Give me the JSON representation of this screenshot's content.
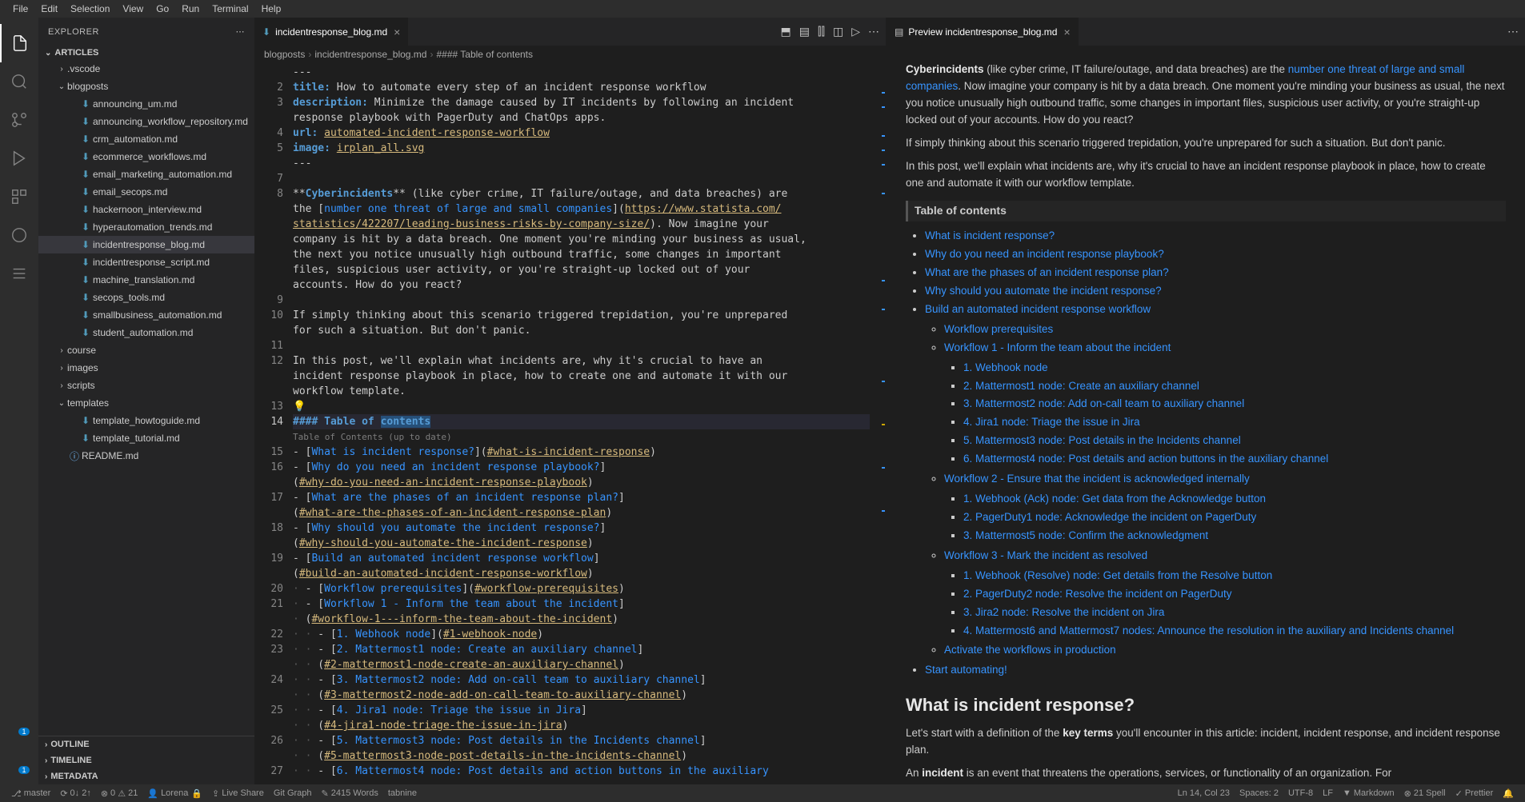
{
  "menubar": [
    "File",
    "Edit",
    "Selection",
    "View",
    "Go",
    "Run",
    "Terminal",
    "Help"
  ],
  "sidebar": {
    "title": "EXPLORER",
    "root": "ARTICLES",
    "tree": [
      {
        "type": "folder",
        "name": ".vscode",
        "depth": 1,
        "expanded": false
      },
      {
        "type": "folder",
        "name": "blogposts",
        "depth": 1,
        "expanded": true
      },
      {
        "type": "file",
        "name": "announcing_um.md",
        "depth": 2
      },
      {
        "type": "file",
        "name": "announcing_workflow_repository.md",
        "depth": 2
      },
      {
        "type": "file",
        "name": "crm_automation.md",
        "depth": 2
      },
      {
        "type": "file",
        "name": "ecommerce_workflows.md",
        "depth": 2
      },
      {
        "type": "file",
        "name": "email_marketing_automation.md",
        "depth": 2
      },
      {
        "type": "file",
        "name": "email_secops.md",
        "depth": 2
      },
      {
        "type": "file",
        "name": "hackernoon_interview.md",
        "depth": 2
      },
      {
        "type": "file",
        "name": "hyperautomation_trends.md",
        "depth": 2
      },
      {
        "type": "file",
        "name": "incidentresponse_blog.md",
        "depth": 2,
        "selected": true
      },
      {
        "type": "file",
        "name": "incidentresponse_script.md",
        "depth": 2
      },
      {
        "type": "file",
        "name": "machine_translation.md",
        "depth": 2
      },
      {
        "type": "file",
        "name": "secops_tools.md",
        "depth": 2
      },
      {
        "type": "file",
        "name": "smallbusiness_automation.md",
        "depth": 2
      },
      {
        "type": "file",
        "name": "student_automation.md",
        "depth": 2
      },
      {
        "type": "folder",
        "name": "course",
        "depth": 1,
        "expanded": false
      },
      {
        "type": "folder",
        "name": "images",
        "depth": 1,
        "expanded": false
      },
      {
        "type": "folder",
        "name": "scripts",
        "depth": 1,
        "expanded": false
      },
      {
        "type": "folder",
        "name": "templates",
        "depth": 1,
        "expanded": true
      },
      {
        "type": "file",
        "name": "template_howtoguide.md",
        "depth": 2
      },
      {
        "type": "file",
        "name": "template_tutorial.md",
        "depth": 2
      },
      {
        "type": "file",
        "name": "README.md",
        "depth": 1,
        "icon": "info"
      }
    ],
    "collapsed": [
      "OUTLINE",
      "TIMELINE",
      "METADATA"
    ]
  },
  "leftTab": {
    "name": "incidentresponse_blog.md"
  },
  "rightTab": {
    "name": "Preview incidentresponse_blog.md"
  },
  "breadcrumbs": [
    "blogposts",
    "incidentresponse_blog.md",
    "#### Table of contents"
  ],
  "editorLines": [
    {
      "n": "",
      "html": "---"
    },
    {
      "n": "2",
      "html": "<span class='mtk-key'>title:</span> How to automate every step of an incident response workflow"
    },
    {
      "n": "3",
      "html": "<span class='mtk-key'>description:</span> Minimize the damage caused by IT incidents by following an incident"
    },
    {
      "n": "",
      "html": "response playbook with PagerDuty and ChatOps apps."
    },
    {
      "n": "4",
      "html": "<span class='mtk-key'>url:</span> <span class='mtk-link'>automated-incident-response-workflow</span>"
    },
    {
      "n": "5",
      "html": "<span class='mtk-key'>image:</span> <span class='mtk-link'>irplan_all.svg</span>"
    },
    {
      "n": "",
      "html": "---"
    },
    {
      "n": "7",
      "html": ""
    },
    {
      "n": "8",
      "html": "**<span class='mtk-bold'>Cyberincidents</span>** (like cyber crime, IT failure/outage, and data breaches) are"
    },
    {
      "n": "",
      "html": "the [<span class='mtk-link2'>number one threat of large and small companies</span>](<span class='mtk-link'>https://www.statista.com/</span>"
    },
    {
      "n": "",
      "html": "<span class='mtk-link'>statistics/422207/leading-business-risks-by-company-size/</span>). Now imagine your"
    },
    {
      "n": "",
      "html": "company is hit by a data breach. One moment you're minding your business as usual,"
    },
    {
      "n": "",
      "html": "the next you notice unusually high outbound traffic, some changes in important"
    },
    {
      "n": "",
      "html": "files, suspicious user activity, or you're straight-up locked out of your"
    },
    {
      "n": "",
      "html": "accounts. How do you react?"
    },
    {
      "n": "9",
      "html": ""
    },
    {
      "n": "10",
      "html": "If simply thinking about this scenario triggered trepidation, you're unprepared"
    },
    {
      "n": "",
      "html": "for such a situation. But don't panic."
    },
    {
      "n": "11",
      "html": ""
    },
    {
      "n": "12",
      "html": "In this post, we'll explain what incidents are, why it's crucial to have an"
    },
    {
      "n": "",
      "html": "incident response playbook in place, how to create one and automate it with our"
    },
    {
      "n": "",
      "html": "workflow template."
    },
    {
      "n": "13",
      "html": "<span class='lightbulb'>💡</span>"
    },
    {
      "n": "14",
      "html": "<span class='mtk-head'>#### Table of <span style='background:#264f78'>contents</span></span>",
      "hl": true
    },
    {
      "n": "",
      "html": "<span class='code-hint'>Table of Contents (up to date)</span>"
    },
    {
      "n": "15",
      "html": "- [<span class='mtk-link2'>What is incident response?</span>](<span class='mtk-link'>#what-is-incident-response</span>)"
    },
    {
      "n": "16",
      "html": "- [<span class='mtk-link2'>Why do you need an incident response playbook?</span>]"
    },
    {
      "n": "",
      "html": "(<span class='mtk-link'>#why-do-you-need-an-incident-response-playbook</span>)"
    },
    {
      "n": "17",
      "html": "- [<span class='mtk-link2'>What are the phases of an incident response plan?</span>]"
    },
    {
      "n": "",
      "html": "(<span class='mtk-link'>#what-are-the-phases-of-an-incident-response-plan</span>)"
    },
    {
      "n": "18",
      "html": "- [<span class='mtk-link2'>Why should you automate the incident response?</span>]"
    },
    {
      "n": "",
      "html": "(<span class='mtk-link'>#why-should-you-automate-the-incident-response</span>)"
    },
    {
      "n": "19",
      "html": "- [<span class='mtk-link2'>Build an automated incident response workflow</span>]"
    },
    {
      "n": "",
      "html": "(<span class='mtk-link'>#build-an-automated-incident-response-workflow</span>)"
    },
    {
      "n": "20",
      "html": "<span style='color:#5a5a5a'>·</span> - [<span class='mtk-link2'>Workflow prerequisites</span>](<span class='mtk-link'>#workflow-prerequisites</span>)"
    },
    {
      "n": "21",
      "html": "<span style='color:#5a5a5a'>·</span> - [<span class='mtk-link2'>Workflow 1 - Inform the team about the incident</span>]"
    },
    {
      "n": "",
      "html": "<span style='color:#5a5a5a'>·</span> (<span class='mtk-link'>#workflow-1---inform-the-team-about-the-incident</span>)"
    },
    {
      "n": "22",
      "html": "<span style='color:#5a5a5a'>· ·</span> - [<span class='mtk-link2'>1. Webhook node</span>](<span class='mtk-link'>#1-webhook-node</span>)"
    },
    {
      "n": "23",
      "html": "<span style='color:#5a5a5a'>· ·</span> - [<span class='mtk-link2'>2. Mattermost1 node: Create an auxiliary channel</span>]"
    },
    {
      "n": "",
      "html": "<span style='color:#5a5a5a'>· ·</span> (<span class='mtk-link'>#2-mattermost1-node-create-an-auxiliary-channel</span>)"
    },
    {
      "n": "24",
      "html": "<span style='color:#5a5a5a'>· ·</span> - [<span class='mtk-link2'>3. Mattermost2 node: Add on-call team to auxiliary channel</span>]"
    },
    {
      "n": "",
      "html": "<span style='color:#5a5a5a'>· ·</span> (<span class='mtk-link'>#3-mattermost2-node-add-on-call-team-to-auxiliary-channel</span>)"
    },
    {
      "n": "25",
      "html": "<span style='color:#5a5a5a'>· ·</span> - [<span class='mtk-link2'>4. Jira1 node: Triage the issue in Jira</span>]"
    },
    {
      "n": "",
      "html": "<span style='color:#5a5a5a'>· ·</span> (<span class='mtk-link'>#4-jira1-node-triage-the-issue-in-jira</span>)"
    },
    {
      "n": "26",
      "html": "<span style='color:#5a5a5a'>· ·</span> - [<span class='mtk-link2'>5. Mattermost3 node: Post details in the Incidents channel</span>]"
    },
    {
      "n": "",
      "html": "<span style='color:#5a5a5a'>· ·</span> (<span class='mtk-link'>#5-mattermost3-node-post-details-in-the-incidents-channel</span>)"
    },
    {
      "n": "27",
      "html": "<span style='color:#5a5a5a'>· ·</span> - [<span class='mtk-link2'>6. Mattermost4 node: Post details and action buttons in the auxiliary</span>"
    }
  ],
  "preview": {
    "para1a": "Cyberincidents",
    "para1b": " (like cyber crime, IT failure/outage, and data breaches) are the ",
    "para1link": "number one threat of large and small companies",
    "para1c": ". Now imagine your company is hit by a data breach. One moment you're minding your business as usual, the next you notice unusually high outbound traffic, some changes in important files, suspicious user activity, or you're straight-up locked out of your accounts. How do you react?",
    "para2": "If simply thinking about this scenario triggered trepidation, you're unprepared for such a situation. But don't panic.",
    "para3": "In this post, we'll explain what incidents are, why it's crucial to have an incident response playbook in place, how to create one and automate it with our workflow template.",
    "tocTitle": "Table of contents",
    "toc": [
      {
        "t": "What is incident response?"
      },
      {
        "t": "Why do you need an incident response playbook?"
      },
      {
        "t": "What are the phases of an incident response plan?"
      },
      {
        "t": "Why should you automate the incident response?"
      },
      {
        "t": "Build an automated incident response workflow",
        "children": [
          {
            "t": "Workflow prerequisites"
          },
          {
            "t": "Workflow 1 - Inform the team about the incident",
            "children": [
              {
                "t": "1. Webhook node"
              },
              {
                "t": "2. Mattermost1 node: Create an auxiliary channel"
              },
              {
                "t": "3. Mattermost2 node: Add on-call team to auxiliary channel"
              },
              {
                "t": "4. Jira1 node: Triage the issue in Jira"
              },
              {
                "t": "5. Mattermost3 node: Post details in the Incidents channel"
              },
              {
                "t": "6. Mattermost4 node: Post details and action buttons in the auxiliary channel"
              }
            ]
          },
          {
            "t": "Workflow 2 - Ensure that the incident is acknowledged internally",
            "children": [
              {
                "t": "1. Webhook (Ack) node: Get data from the Acknowledge button"
              },
              {
                "t": "2. PagerDuty1 node: Acknowledge the incident on PagerDuty"
              },
              {
                "t": "3. Mattermost5 node: Confirm the acknowledgment"
              }
            ]
          },
          {
            "t": "Workflow 3 - Mark the incident as resolved",
            "children": [
              {
                "t": "1. Webhook (Resolve) node: Get details from the Resolve button"
              },
              {
                "t": "2. PagerDuty2 node: Resolve the incident on PagerDuty"
              },
              {
                "t": "3. Jira2 node: Resolve the incident on Jira"
              },
              {
                "t": "4. Mattermost6 and Mattermost7 nodes: Announce the resolution in the auxiliary and Incidents channel"
              }
            ]
          },
          {
            "t": "Activate the workflows in production"
          }
        ]
      },
      {
        "t": "Start automating!"
      }
    ],
    "h2": "What is incident response?",
    "para4a": "Let's start with a definition of the ",
    "para4b": "key terms",
    "para4c": " you'll encounter in this article: incident, incident response, and incident response plan.",
    "para5a": "An ",
    "para5b": "incident",
    "para5c": " is an event that threatens the operations, services, or functionality of an organization. For"
  },
  "statusbar": {
    "branch": "master",
    "sync": "0↓ 2↑",
    "errors": "0",
    "warnings": "21",
    "user": "Lorena",
    "liveshare": "Live Share",
    "gitgraph": "Git Graph",
    "words": "2415 Words",
    "tabnine": "tabnine",
    "cursor": "Ln 14, Col 23",
    "spaces": "Spaces: 2",
    "encoding": "UTF-8",
    "eol": "LF",
    "lang": "Markdown",
    "spell": "21 Spell",
    "prettier": "Prettier",
    "bell": ""
  }
}
